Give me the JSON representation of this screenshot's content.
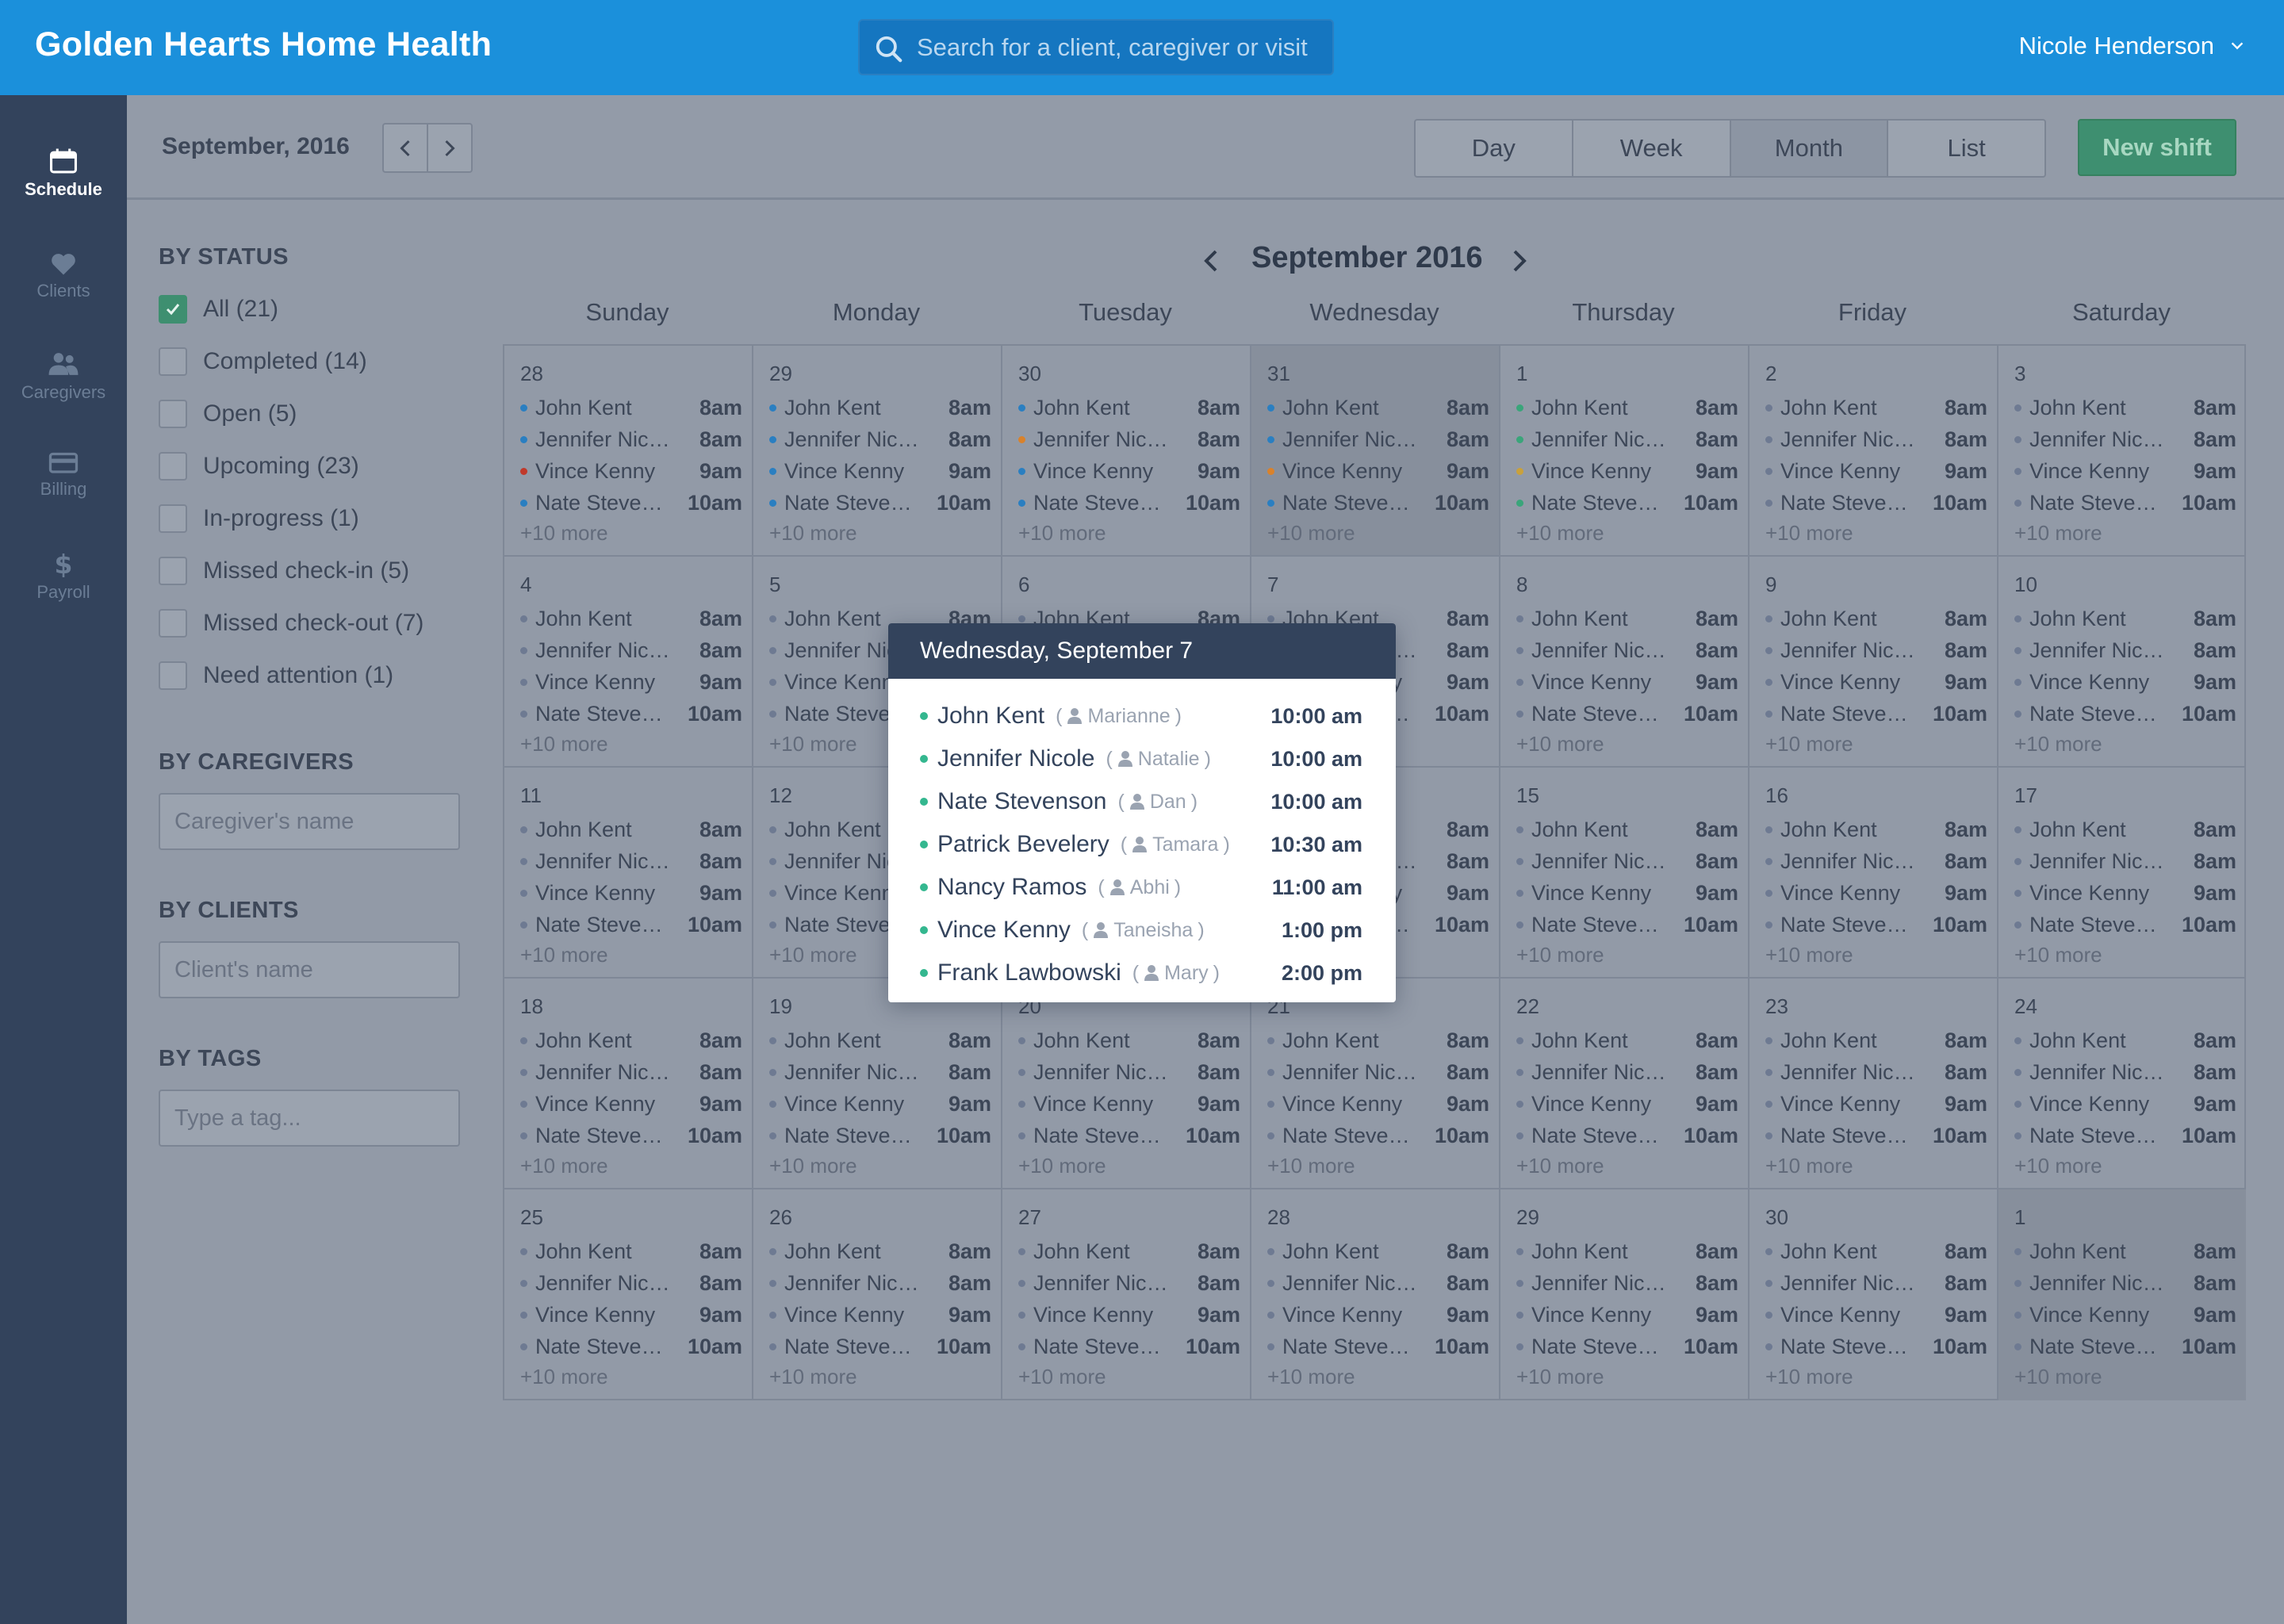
{
  "app": {
    "title": "Golden Hearts Home Health"
  },
  "search": {
    "placeholder": "Search for a client, caregiver or visit"
  },
  "user": {
    "name": "Nicole Henderson"
  },
  "nav": [
    {
      "label": "Schedule",
      "icon": "calendar-icon",
      "active": true
    },
    {
      "label": "Clients",
      "icon": "heart-icon",
      "active": false
    },
    {
      "label": "Caregivers",
      "icon": "people-icon",
      "active": false
    },
    {
      "label": "Billing",
      "icon": "credit-card-icon",
      "active": false
    },
    {
      "label": "Payroll",
      "icon": "dollar-icon",
      "active": false
    }
  ],
  "toolbar": {
    "current_month": "September, 2016",
    "views": [
      "Day",
      "Week",
      "Month",
      "List"
    ],
    "active_view": "Month",
    "new_shift_label": "New shift"
  },
  "filters": {
    "status_heading": "BY STATUS",
    "statuses": [
      {
        "label": "All (21)",
        "checked": true
      },
      {
        "label": "Completed (14)",
        "checked": false
      },
      {
        "label": "Open (5)",
        "checked": false
      },
      {
        "label": "Upcoming (23)",
        "checked": false
      },
      {
        "label": "In-progress (1)",
        "checked": false
      },
      {
        "label": "Missed check-in (5)",
        "checked": false
      },
      {
        "label": "Missed check-out (7)",
        "checked": false
      },
      {
        "label": "Need attention (1)",
        "checked": false
      }
    ],
    "caregivers_heading": "BY CAREGIVERS",
    "caregivers_placeholder": "Caregiver's name",
    "clients_heading": "BY CLIENTS",
    "clients_placeholder": "Client's name",
    "tags_heading": "BY TAGS",
    "tags_placeholder": "Type a tag..."
  },
  "calendar": {
    "title": "September 2016",
    "weekdays": [
      "Sunday",
      "Monday",
      "Tuesday",
      "Wednesday",
      "Thursday",
      "Friday",
      "Saturday"
    ],
    "more_label": "+10 more",
    "days": [
      "28",
      "29",
      "30",
      "31",
      "1",
      "2",
      "3",
      "4",
      "5",
      "6",
      "7",
      "8",
      "9",
      "10",
      "11",
      "12",
      "13",
      "14",
      "15",
      "16",
      "17",
      "18",
      "19",
      "20",
      "21",
      "22",
      "23",
      "24",
      "25",
      "26",
      "27",
      "28",
      "29",
      "30",
      "1"
    ],
    "shaded_days": [
      3,
      34
    ],
    "event_names": [
      "John Kent",
      "Jennifer Nicole",
      "Vince Kenny",
      "Nate Stevenson"
    ],
    "event_times": [
      "8am",
      "8am",
      "9am",
      "10am"
    ],
    "status_colors": {
      "default": "#6e7a92",
      "scheduled": "#2a7fc1",
      "completed": "#3aa57a",
      "missed": "#c0392b",
      "warning": "#d9822b",
      "pending": "#c9a13c"
    },
    "week1_dot_status": [
      [
        "scheduled",
        "scheduled",
        "missed",
        "scheduled"
      ],
      [
        "scheduled",
        "scheduled",
        "scheduled",
        "scheduled"
      ],
      [
        "scheduled",
        "warning",
        "scheduled",
        "scheduled"
      ],
      [
        "scheduled",
        "scheduled",
        "warning",
        "scheduled"
      ],
      [
        "completed",
        "completed",
        "pending",
        "completed"
      ],
      [
        "default",
        "default",
        "default",
        "default"
      ],
      [
        "default",
        "default",
        "default",
        "default"
      ]
    ]
  },
  "popover": {
    "title": "Wednesday, September 7",
    "visits": [
      {
        "client": "John Kent",
        "caregiver": "Marianne",
        "time": "10:00 am"
      },
      {
        "client": "Jennifer Nicole",
        "caregiver": "Natalie",
        "time": "10:00 am"
      },
      {
        "client": "Nate Stevenson",
        "caregiver": "Dan",
        "time": "10:00 am"
      },
      {
        "client": "Patrick Bevelery",
        "caregiver": "Tamara",
        "time": "10:30 am"
      },
      {
        "client": "Nancy Ramos",
        "caregiver": "Abhi",
        "time": "11:00 am"
      },
      {
        "client": "Vince Kenny",
        "caregiver": "Taneisha",
        "time": "1:00 pm"
      },
      {
        "client": "Frank Lawbowski",
        "caregiver": "Mary",
        "time": "2:00 pm"
      }
    ]
  }
}
